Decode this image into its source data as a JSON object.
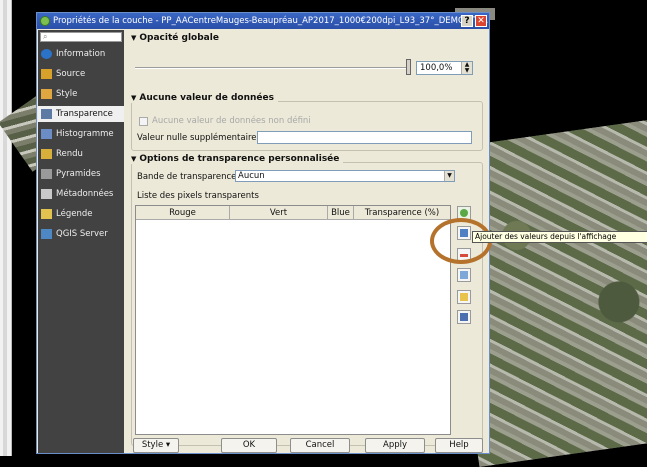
{
  "window": {
    "title": "Propriétés de la couche - PP_AACentreMauges-Beaupréau_AP2017_1000€200dpi_L93_37°_DEMO | Tra...",
    "help_glyph": "?",
    "close_glyph": "✕"
  },
  "sidebar": {
    "search_placeholder": "",
    "items": [
      {
        "label": "Information",
        "icon": "info-icon",
        "color": "#2b73c8"
      },
      {
        "label": "Source",
        "icon": "source-icon",
        "color": "#d8a22a"
      },
      {
        "label": "Style",
        "icon": "style-icon",
        "color": "#e0a640"
      },
      {
        "label": "Transparence",
        "icon": "transparency-icon",
        "color": "#5d7aa5"
      },
      {
        "label": "Histogramme",
        "icon": "histogram-icon",
        "color": "#6b8cc4"
      },
      {
        "label": "Rendu",
        "icon": "render-icon",
        "color": "#d7b03c"
      },
      {
        "label": "Pyramides",
        "icon": "pyramids-icon",
        "color": "#9a9a9a"
      },
      {
        "label": "Métadonnées",
        "icon": "metadata-icon",
        "color": "#c9c9c9"
      },
      {
        "label": "Légende",
        "icon": "legend-icon",
        "color": "#e3c34f"
      },
      {
        "label": "QGIS Server",
        "icon": "qgis-server-icon",
        "color": "#4d88c4"
      }
    ],
    "active_index": 3
  },
  "opacity": {
    "title": "Opacité globale",
    "value": "100,0%"
  },
  "nodata": {
    "title": "Aucune valeur de données",
    "checkbox_label": "Aucune valeur de données  non défini",
    "extra_label": "Valeur nulle supplémentaire",
    "extra_value": ""
  },
  "custom": {
    "title": "Options de transparence personnalisée",
    "band_label": "Bande de transparence",
    "band_value": "Aucun",
    "list_label": "Liste des pixels transparents",
    "columns": [
      "Rouge",
      "Vert",
      "Blue",
      "Transparence (%)"
    ]
  },
  "tooltip": "Ajouter des valeurs depuis l'affichage",
  "buttons": {
    "style": "Style",
    "ok": "OK",
    "cancel": "Cancel",
    "apply": "Apply",
    "help": "Help"
  }
}
